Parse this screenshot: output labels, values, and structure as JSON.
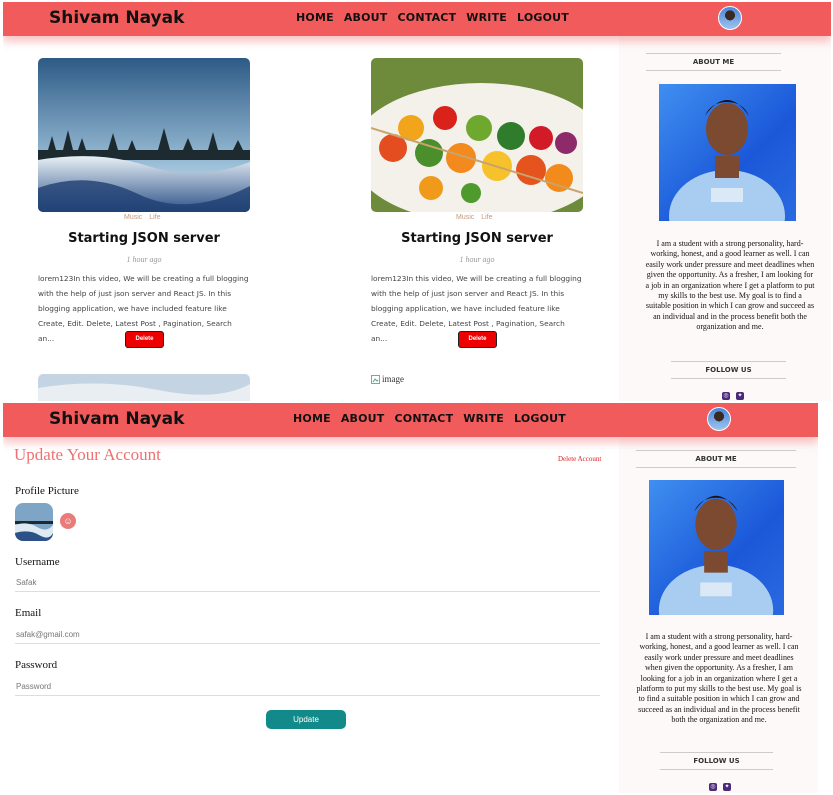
{
  "navbar": {
    "brand": "Shivam Nayak",
    "links": [
      "HOME",
      "ABOUT",
      "CONTACT",
      "WRITE",
      "LOGOUT"
    ]
  },
  "posts": [
    {
      "categories": [
        "Music",
        "Life"
      ],
      "title": "Starting JSON server",
      "date": "1 hour ago",
      "description": "lorem123In this video, We will be creating a full blogging with the help of just json server and React JS. In this blogging application, we have included feature like Create, Edit. Delete, Latest Post , Pagination, Search an...",
      "delete_label": "Delete"
    },
    {
      "categories": [
        "Music",
        "Life"
      ],
      "title": "Starting JSON server",
      "date": "1 hour ago",
      "description": "lorem123In this video, We will be creating a full blogging with the help of just json server and React JS. In this blogging application, we have included feature like Create, Edit. Delete, Latest Post , Pagination, Search an...",
      "delete_label": "Delete"
    }
  ],
  "broken_image_alt": "image",
  "sidebar": {
    "about_title": "ABOUT ME",
    "about_text": "I am a student with a strong personality, hard-working, honest, and a good learner as well. I can easily work under pressure and meet deadlines when given the opportunity. As a fresher, I am looking for a job in an organization where I get a platform to put my skills to the best use. My goal is to find a suitable position in which I can grow and succeed as an individual and in the process benefit both the organization and me.",
    "follow_title": "FOLLOW US",
    "social_icons": [
      "instagram-icon",
      "twitter-icon"
    ]
  },
  "settings": {
    "title": "Update Your Account",
    "delete_account": "Delete Account",
    "profile_picture_label": "Profile Picture",
    "username_label": "Username",
    "username_placeholder": "Safak",
    "email_label": "Email",
    "email_placeholder": "safak@gmail.com",
    "password_label": "Password",
    "password_placeholder": "Password",
    "update_label": "Update"
  },
  "colors": {
    "navbar": "#f25b5b",
    "title_accent": "#f07070",
    "delete_red": "#ee0000",
    "update_teal": "#138a8a",
    "category": "#c59a7c"
  }
}
